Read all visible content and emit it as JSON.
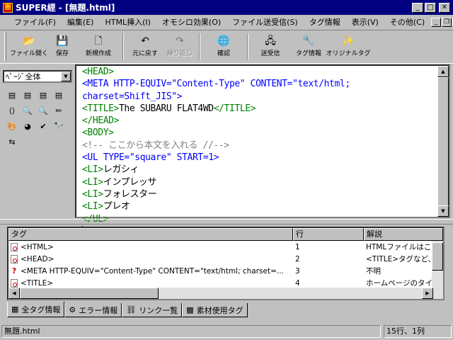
{
  "window": {
    "title": "SUPER䋥 - [無題.html]",
    "app_icon": "圏"
  },
  "menu": {
    "items": [
      "ファイル(F)",
      "編集(E)",
      "HTML挿入(I)",
      "オモシロ効果(O)",
      "ファイル送受信(S)",
      "タグ情報",
      "表示(V)",
      "その他(C)"
    ]
  },
  "toolbar": {
    "buttons": [
      {
        "label": "ファイル開く",
        "icon": "open-folder-icon",
        "glyph": "📂",
        "enabled": true
      },
      {
        "label": "保存",
        "icon": "save-disk-icon",
        "glyph": "💾",
        "enabled": true
      },
      {
        "label": "新規作成",
        "icon": "new-file-icon",
        "glyph": "🗋",
        "enabled": true
      },
      {
        "label": "元に戻す",
        "icon": "undo-icon",
        "glyph": "↶",
        "enabled": true
      },
      {
        "label": "繰り返し",
        "icon": "redo-icon",
        "glyph": "↷",
        "enabled": false
      },
      {
        "label": "確認",
        "icon": "globe-icon",
        "glyph": "🌐",
        "enabled": true
      },
      {
        "label": "送受信",
        "icon": "transfer-icon",
        "glyph": "🖧",
        "enabled": true
      },
      {
        "label": "タグ情報",
        "icon": "tag-info-icon",
        "glyph": "🔧",
        "enabled": true
      },
      {
        "label": "オリジナルタグ",
        "icon": "original-tag-icon",
        "glyph": "✨",
        "enabled": true
      }
    ]
  },
  "left_panel": {
    "combo_value": "ﾍﾟｰｼﾞ全体",
    "icons": [
      [
        "doc-icon",
        "doc-b-icon",
        "doc-c-icon",
        "doc-d-icon"
      ],
      [
        "tag-brackets-icon",
        "zoom-in-icon",
        "zoom-out-icon",
        "eraser-icon"
      ],
      [
        "color-all-icon",
        "color-wheel-icon",
        "check-icon",
        "binoculars-icon"
      ],
      [
        "convert-icon"
      ]
    ],
    "icon_glyphs": [
      [
        "▤",
        "▤",
        "▤",
        "▤"
      ],
      [
        "⟨⟩",
        "🔍",
        "🔍",
        "✏"
      ],
      [
        "🎨",
        "◕",
        "✔",
        "🔭"
      ],
      [
        "⇆"
      ]
    ]
  },
  "editor": {
    "lines": [
      [
        {
          "t": "<HEAD>",
          "c": "tag"
        }
      ],
      [
        {
          "t": "<META HTTP-EQUIV=\"Content-Type\" CONTENT=\"text/html;",
          "c": "attr"
        }
      ],
      [
        {
          "t": "charset=Shift_JIS\">",
          "c": "attr"
        }
      ],
      [
        {
          "t": "<TITLE>",
          "c": "tag"
        },
        {
          "t": "The SUBARU FLAT4WD",
          "c": "txt"
        },
        {
          "t": "</TITLE>",
          "c": "tag"
        }
      ],
      [
        {
          "t": "</HEAD>",
          "c": "tag"
        }
      ],
      [
        {
          "t": "<BODY>",
          "c": "tag"
        }
      ],
      [
        {
          "t": "<!-- ここから本文を入れる //-->",
          "c": "comment"
        }
      ],
      [
        {
          "t": "<UL TYPE=\"square\" START=1>",
          "c": "attr"
        }
      ],
      [
        {
          "t": "<LI>",
          "c": "tag"
        },
        {
          "t": "レガシィ",
          "c": "txt"
        }
      ],
      [
        {
          "t": "<LI>",
          "c": "tag"
        },
        {
          "t": "インプレッサ",
          "c": "txt"
        }
      ],
      [
        {
          "t": "<LI>",
          "c": "tag"
        },
        {
          "t": "フォレスター",
          "c": "txt"
        }
      ],
      [
        {
          "t": "<LI>",
          "c": "tag"
        },
        {
          "t": "プレオ",
          "c": "txt"
        }
      ],
      [
        {
          "t": "</UL>",
          "c": "tag"
        }
      ]
    ]
  },
  "tag_list": {
    "columns": [
      "タグ",
      "行",
      "解説"
    ],
    "rows": [
      {
        "tag": "<HTML>",
        "line": "1",
        "desc": "HTMLファイルはこの",
        "icon": "doc"
      },
      {
        "tag": "<HEAD>",
        "line": "2",
        "desc": "<TITLE>タグなど、ド",
        "icon": "doc"
      },
      {
        "tag": "<META HTTP-EQUIV=\"Content-Type\" CONTENT=\"text/html; charset=...",
        "line": "3",
        "desc": "不明",
        "icon": "question"
      },
      {
        "tag": "<TITLE>",
        "line": "4",
        "desc": "ホームページのタイト",
        "icon": "doc"
      }
    ]
  },
  "tabs": [
    {
      "label": "全タグ情報",
      "icon": "all-tags-icon",
      "glyph": "▦",
      "active": true
    },
    {
      "label": "エラー情報",
      "icon": "error-info-icon",
      "glyph": "⚙",
      "active": false
    },
    {
      "label": "リンク一覧",
      "icon": "link-list-icon",
      "glyph": "⛓",
      "active": false
    },
    {
      "label": "素材使用タグ",
      "icon": "material-tag-icon",
      "glyph": "▩",
      "active": false
    }
  ],
  "status": {
    "filename": "無題.html",
    "position": "15行、1列"
  },
  "colors": {
    "tag": "#008000",
    "attr": "#0000ff",
    "comment": "#808080",
    "titlebar": "#000080"
  }
}
